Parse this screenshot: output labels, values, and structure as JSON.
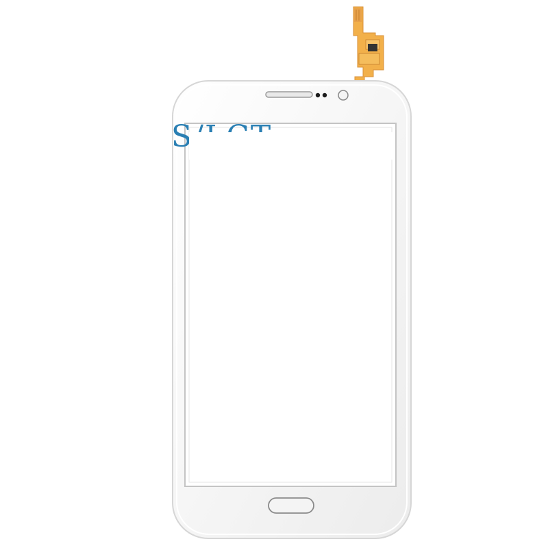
{
  "product": {
    "kind": "touch screen digitizer glass panel",
    "color": "white"
  },
  "watermark": {
    "text": "S/LCT",
    "color": "#2a7fb3"
  },
  "parts": {
    "flex_cable_color": "#f2b04a",
    "chip_color": "#333333",
    "frame_color": "#f8f8f8"
  }
}
